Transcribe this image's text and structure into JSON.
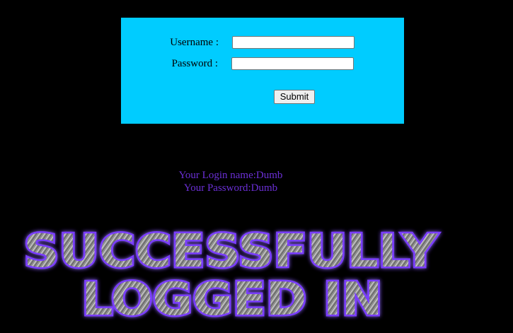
{
  "form": {
    "username_label": "Username :",
    "password_label": "Password :",
    "username_value": "",
    "password_value": "",
    "submit_label": "Submit"
  },
  "result": {
    "login_name_line": "Your Login name:Dumb",
    "password_line": "Your Password:Dumb"
  },
  "banner": {
    "line1": "SUCCESSFULLY",
    "line2": "LOGGED IN"
  },
  "colors": {
    "page_background": "#000000",
    "form_background": "#00ccff",
    "result_text": "#6b2fd6",
    "banner_glow": "#7a3cff",
    "banner_fill": "#9a9a9a"
  }
}
